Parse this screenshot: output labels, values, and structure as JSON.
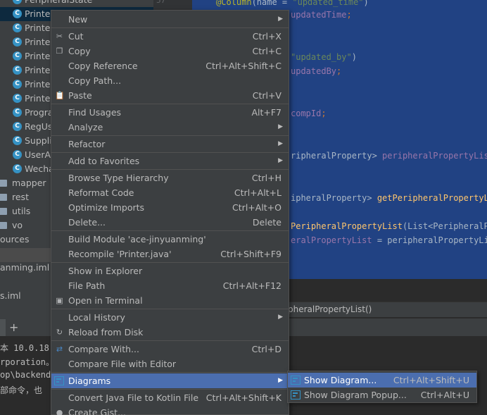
{
  "tree": {
    "rows": [
      {
        "kind": "class",
        "label": "PeripheralState"
      },
      {
        "kind": "class",
        "label": "Printer"
      },
      {
        "kind": "class",
        "label": "Printer"
      },
      {
        "kind": "class",
        "label": "Printer"
      },
      {
        "kind": "class",
        "label": "Printer"
      },
      {
        "kind": "class",
        "label": "Printer"
      },
      {
        "kind": "class",
        "label": "Printer"
      },
      {
        "kind": "class",
        "label": "Printer"
      },
      {
        "kind": "class",
        "label": "Progra"
      },
      {
        "kind": "class",
        "label": "RegUs"
      },
      {
        "kind": "class",
        "label": "Suppli"
      },
      {
        "kind": "class",
        "label": "UserA"
      },
      {
        "kind": "class",
        "label": "Wecha"
      },
      {
        "kind": "folder",
        "label": "mapper"
      },
      {
        "kind": "folder",
        "label": "rest"
      },
      {
        "kind": "folder",
        "label": "utils"
      },
      {
        "kind": "folder",
        "label": "vo"
      },
      {
        "kind": "plain",
        "label": "ources"
      },
      {
        "kind": "plain",
        "label": ""
      },
      {
        "kind": "plain",
        "label": "anming.iml"
      },
      {
        "kind": "plain",
        "label": ""
      },
      {
        "kind": "plain",
        "label": "s.iml"
      }
    ],
    "gutter_number": "57"
  },
  "editor": {
    "lines": [
      {
        "parts": [
          [
            "ann",
            "@Column"
          ],
          [
            "id",
            "(name = "
          ],
          [
            "str",
            "\"updated_time\""
          ],
          [
            "id",
            ")"
          ]
        ]
      },
      {
        "parts": [
          [
            "fld",
            "updatedTime"
          ],
          [
            "kw",
            ";"
          ]
        ]
      },
      {
        "parts": [
          [
            "str",
            "\"updated_by\""
          ],
          [
            "id",
            ")"
          ]
        ]
      },
      {
        "parts": [
          [
            "fld",
            "updatedBy"
          ],
          [
            "kw",
            ";"
          ]
        ]
      },
      {
        "parts": [
          [
            "fld",
            "compId"
          ],
          [
            "kw",
            ";"
          ]
        ]
      },
      {
        "parts": [
          [
            "id",
            "ripheralProperty> "
          ],
          [
            "fld",
            "peripheralPropertyList"
          ]
        ]
      },
      {
        "parts": [
          [
            "id",
            "ipheralProperty> "
          ],
          [
            "method",
            "getPeripheralPropertyLi"
          ]
        ]
      },
      {
        "parts": [
          [
            "method",
            "PeripheralPropertyList"
          ],
          [
            "id",
            "(List<PeripheralPr"
          ]
        ]
      },
      {
        "parts": [
          [
            "fld",
            "eralPropertyList"
          ],
          [
            "id",
            " = peripheralPropertyLis"
          ]
        ]
      }
    ],
    "breadcrumb": "pheralPropertyList()"
  },
  "terminal": {
    "lines": [
      "本 10.0.18",
      "rporation。",
      "op\\backend-",
      "部命令，也"
    ]
  },
  "context_menu": {
    "items": [
      {
        "label": "New",
        "shortcut": "",
        "submenu": true,
        "icon": ""
      },
      {
        "label": "Cut",
        "shortcut": "Ctrl+X",
        "submenu": false,
        "icon": "scissors-icon"
      },
      {
        "label": "Copy",
        "shortcut": "Ctrl+C",
        "submenu": false,
        "icon": "copy-icon"
      },
      {
        "label": "Copy Reference",
        "shortcut": "Ctrl+Alt+Shift+C",
        "submenu": false,
        "icon": ""
      },
      {
        "label": "Copy Path...",
        "shortcut": "",
        "submenu": false,
        "icon": ""
      },
      {
        "label": "Paste",
        "shortcut": "Ctrl+V",
        "submenu": false,
        "icon": "paste-icon"
      },
      {
        "label": "Find Usages",
        "shortcut": "Alt+F7",
        "submenu": false,
        "icon": ""
      },
      {
        "label": "Analyze",
        "shortcut": "",
        "submenu": true,
        "icon": ""
      },
      {
        "label": "Refactor",
        "shortcut": "",
        "submenu": true,
        "icon": ""
      },
      {
        "label": "Add to Favorites",
        "shortcut": "",
        "submenu": true,
        "icon": ""
      },
      {
        "label": "Browse Type Hierarchy",
        "shortcut": "Ctrl+H",
        "submenu": false,
        "icon": ""
      },
      {
        "label": "Reformat Code",
        "shortcut": "Ctrl+Alt+L",
        "submenu": false,
        "icon": ""
      },
      {
        "label": "Optimize Imports",
        "shortcut": "Ctrl+Alt+O",
        "submenu": false,
        "icon": ""
      },
      {
        "label": "Delete...",
        "shortcut": "Delete",
        "submenu": false,
        "icon": ""
      },
      {
        "label": "Build Module 'ace-jinyuanming'",
        "shortcut": "",
        "submenu": false,
        "icon": ""
      },
      {
        "label": "Recompile 'Printer.java'",
        "shortcut": "Ctrl+Shift+F9",
        "submenu": false,
        "icon": ""
      },
      {
        "label": "Show in Explorer",
        "shortcut": "",
        "submenu": false,
        "icon": ""
      },
      {
        "label": "File Path",
        "shortcut": "Ctrl+Alt+F12",
        "submenu": false,
        "icon": ""
      },
      {
        "label": "Open in Terminal",
        "shortcut": "",
        "submenu": false,
        "icon": "terminal-icon"
      },
      {
        "label": "Local History",
        "shortcut": "",
        "submenu": true,
        "icon": ""
      },
      {
        "label": "Reload from Disk",
        "shortcut": "",
        "submenu": false,
        "icon": "reload-icon"
      },
      {
        "label": "Compare With...",
        "shortcut": "Ctrl+D",
        "submenu": false,
        "icon": "compare-icon"
      },
      {
        "label": "Compare File with Editor",
        "shortcut": "",
        "submenu": false,
        "icon": ""
      },
      {
        "label": "Diagrams",
        "shortcut": "",
        "submenu": true,
        "icon": "diagram-icon"
      },
      {
        "label": "Convert Java File to Kotlin File",
        "shortcut": "Ctrl+Alt+Shift+K",
        "submenu": false,
        "icon": ""
      },
      {
        "label": "Create Gist...",
        "shortcut": "",
        "submenu": false,
        "icon": "github-icon"
      }
    ]
  },
  "submenu": {
    "items": [
      {
        "label": "Show Diagram...",
        "shortcut": "Ctrl+Alt+Shift+U"
      },
      {
        "label": "Show Diagram Popup...",
        "shortcut": "Ctrl+Alt+U"
      }
    ]
  },
  "colors": {
    "menu_bg": "#3c3f41",
    "menu_active": "#4b6eaf",
    "editor_selection": "#214283",
    "class_icon": "#3592c4"
  }
}
